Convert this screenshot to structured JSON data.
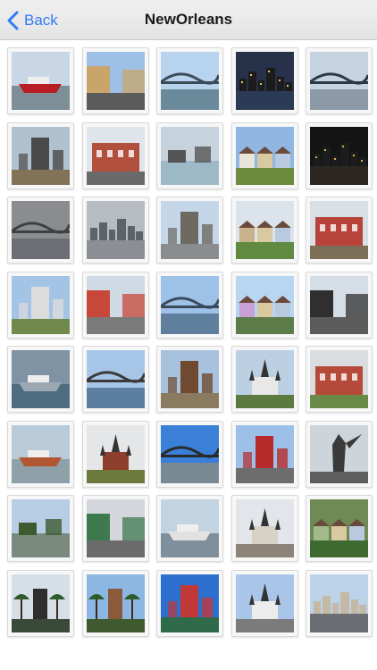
{
  "navbar": {
    "back_label": "Back",
    "title": "NewOrleans",
    "accent_color": "#2f7bf5"
  },
  "gallery": {
    "thumbnails": [
      {
        "sky": "#c9d6e6",
        "ground": "#7d8e96",
        "accent": "#b81d24",
        "shape": "ship"
      },
      {
        "sky": "#9fc0e6",
        "ground": "#5b5b5b",
        "accent": "#c9a56b",
        "shape": "street"
      },
      {
        "sky": "#b8d3ee",
        "ground": "#6a8a9c",
        "accent": "#3b4b57",
        "shape": "bridge"
      },
      {
        "sky": "#27324a",
        "ground": "#2c3b55",
        "accent": "#e6c46a",
        "shape": "skyline-night"
      },
      {
        "sky": "#c6d3e0",
        "ground": "#8b9aa6",
        "accent": "#2d3945",
        "shape": "bridge"
      },
      {
        "sky": "#b0c2cf",
        "ground": "#827257",
        "accent": "#4a4a4a",
        "shape": "tower"
      },
      {
        "sky": "#dfe5ea",
        "ground": "#6a6a6a",
        "accent": "#b1503c",
        "shape": "building"
      },
      {
        "sky": "#c6d3dd",
        "ground": "#9eb9c6",
        "accent": "#555555",
        "shape": "flood"
      },
      {
        "sky": "#8fb7e1",
        "ground": "#6c8b3e",
        "accent": "#e9e4d8",
        "shape": "houses"
      },
      {
        "sky": "#141414",
        "ground": "#2b2620",
        "accent": "#e2b049",
        "shape": "skyline-night"
      },
      {
        "sky": "#8a8c90",
        "ground": "#6c6e73",
        "accent": "#3e3f44",
        "shape": "bridge"
      },
      {
        "sky": "#b7bcc2",
        "ground": "#8b8f93",
        "accent": "#5e6368",
        "shape": "skyline"
      },
      {
        "sky": "#c4d6e8",
        "ground": "#8a8d90",
        "accent": "#6e6a62",
        "shape": "tower"
      },
      {
        "sky": "#dbe4ea",
        "ground": "#5f8a3f",
        "accent": "#c7b28a",
        "shape": "houses"
      },
      {
        "sky": "#d8dfe5",
        "ground": "#7b6f58",
        "accent": "#b8433a",
        "shape": "building"
      },
      {
        "sky": "#a4c4e6",
        "ground": "#6f8a4a",
        "accent": "#dcdcdc",
        "shape": "tower"
      },
      {
        "sky": "#cfdae4",
        "ground": "#7a7a7a",
        "accent": "#c7483a",
        "shape": "street"
      },
      {
        "sky": "#9ec1e8",
        "ground": "#5f7f9c",
        "accent": "#3a4a5e",
        "shape": "bridge"
      },
      {
        "sky": "#b9d6f0",
        "ground": "#5c7c4a",
        "accent": "#c8a0d6",
        "shape": "houses"
      },
      {
        "sky": "#d5dee6",
        "ground": "#5b5b5b",
        "accent": "#2f2f2f",
        "shape": "street"
      },
      {
        "sky": "#7f93a5",
        "ground": "#4f6b7f",
        "accent": "#9ca9b3",
        "shape": "ship"
      },
      {
        "sky": "#a7c6e7",
        "ground": "#5c7fa0",
        "accent": "#3a3a3a",
        "shape": "bridge"
      },
      {
        "sky": "#a8c2dd",
        "ground": "#8a7a60",
        "accent": "#6f4a30",
        "shape": "tower"
      },
      {
        "sky": "#bcd0e4",
        "ground": "#5a7a3f",
        "accent": "#e8e8e8",
        "shape": "cathedral"
      },
      {
        "sky": "#d9dde0",
        "ground": "#6a8a47",
        "accent": "#b54a3a",
        "shape": "building"
      },
      {
        "sky": "#b9cbd8",
        "ground": "#8fa0a8",
        "accent": "#b15733",
        "shape": "ship"
      },
      {
        "sky": "#e5e6e8",
        "ground": "#6c7a3d",
        "accent": "#8f3f2d",
        "shape": "cathedral"
      },
      {
        "sky": "#3a7fd8",
        "ground": "#7a8a95",
        "accent": "#2b2b2b",
        "shape": "bridge"
      },
      {
        "sky": "#9cc0e8",
        "ground": "#6d6d6d",
        "accent": "#b72b2b",
        "shape": "tower"
      },
      {
        "sky": "#cdd5db",
        "ground": "#5e5e5e",
        "accent": "#3a3a3a",
        "shape": "statue"
      },
      {
        "sky": "#b7cde3",
        "ground": "#7b8a7f",
        "accent": "#3e5a30",
        "shape": "flood"
      },
      {
        "sky": "#d3d7db",
        "ground": "#6b6b6b",
        "accent": "#3f7a4f",
        "shape": "street"
      },
      {
        "sky": "#c2d3e2",
        "ground": "#7f8f9b",
        "accent": "#e2e2e2",
        "shape": "ship"
      },
      {
        "sky": "#e2e6ea",
        "ground": "#8c8478",
        "accent": "#d8d2c6",
        "shape": "cathedral"
      },
      {
        "sky": "#6f8a55",
        "ground": "#3f6a2f",
        "accent": "#a2b98a",
        "shape": "houses"
      },
      {
        "sky": "#d6dfe8",
        "ground": "#3a4a38",
        "accent": "#2e2e2e",
        "shape": "palms"
      },
      {
        "sky": "#8cb7e3",
        "ground": "#3f5a2f",
        "accent": "#8a5a3a",
        "shape": "palms"
      },
      {
        "sky": "#2d6fcf",
        "ground": "#2f6a4a",
        "accent": "#c03838",
        "shape": "tower"
      },
      {
        "sky": "#a9c6e8",
        "ground": "#7b7b7b",
        "accent": "#ececec",
        "shape": "cathedral"
      },
      {
        "sky": "#bcd2e8",
        "ground": "#6a6e72",
        "accent": "#c4b9a6",
        "shape": "skyline"
      }
    ]
  }
}
